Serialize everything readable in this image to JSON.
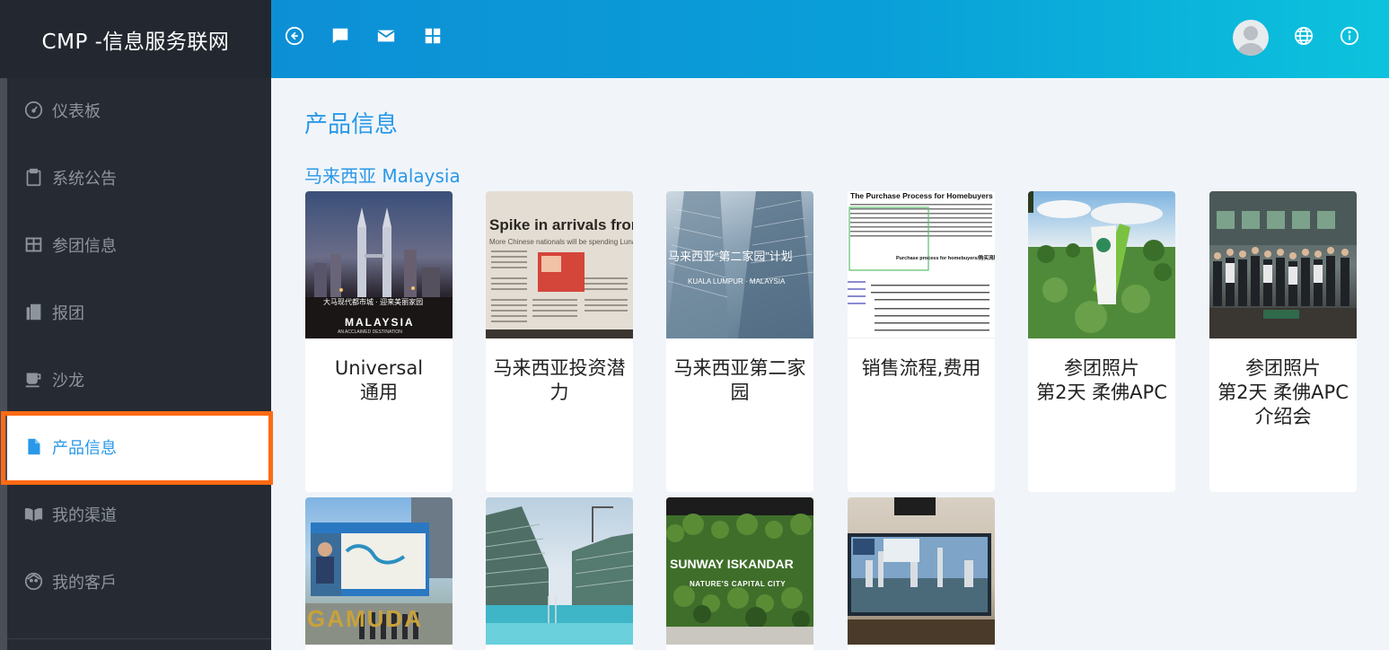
{
  "brand": {
    "title": "CMP -信息服务联网"
  },
  "topbar": {
    "icons": [
      "back-circle-icon",
      "chat-icon",
      "mail-icon",
      "grid-icon"
    ],
    "right_icons": [
      "avatar",
      "globe-icon",
      "info-icon"
    ]
  },
  "sidebar": {
    "items": [
      {
        "label": "仪表板",
        "icon": "dashboard-icon"
      },
      {
        "label": "系统公告",
        "icon": "clipboard-icon"
      },
      {
        "label": "参团信息",
        "icon": "table-icon"
      },
      {
        "label": "报团",
        "icon": "copy-icon"
      },
      {
        "label": "沙龙",
        "icon": "cup-icon"
      },
      {
        "label": "产品信息",
        "icon": "file-icon",
        "active": true
      },
      {
        "label": "我的渠道",
        "icon": "book-icon"
      },
      {
        "label": "我的客戶",
        "icon": "face-icon"
      }
    ]
  },
  "main": {
    "title": "产品信息",
    "section": "马来西亚 Malaysia",
    "cards": [
      {
        "line1": "Universal",
        "line2": "通用",
        "line3": "",
        "thumb_text": "MALAYSIA",
        "thumb_sub": "大马现代都市城 · 迎来美丽家园",
        "thumb_sub2": "AN ACCLAIMED DESTINATION"
      },
      {
        "line1": "马来西亚投资潜",
        "line2": "力",
        "line3": "",
        "thumb_text": "Spike in arrivals from",
        "thumb_sub": "More Chinese nationals will be spending Lunar New Year"
      },
      {
        "line1": "马来西亚第二家",
        "line2": "园",
        "line3": "",
        "thumb_text": "马来西亚“第二家园”计划",
        "thumb_sub": "KUALA LUMPUR · MALAYSIA"
      },
      {
        "line1": "销售流程,费用",
        "line2": "",
        "line3": "",
        "thumb_text": "The Purchase Process for Homebuyers",
        "thumb_sub": "Purchase process for homebuyers/购买流程"
      },
      {
        "line1": "参团照片",
        "line2": "第2天 柔佛APC",
        "line3": ""
      },
      {
        "line1": "参团照片",
        "line2": "第2天 柔佛APC",
        "line3": "介绍会"
      },
      {
        "line1": "",
        "line2": "",
        "line3": "",
        "thumb_text": "GAMUDA"
      },
      {
        "line1": "",
        "line2": "",
        "line3": ""
      },
      {
        "line1": "",
        "line2": "",
        "line3": "",
        "thumb_text": "SUNWAY ISKANDAR",
        "thumb_sub": "NATURE'S CAPITAL CITY"
      },
      {
        "line1": "",
        "line2": "",
        "line3": ""
      }
    ]
  }
}
